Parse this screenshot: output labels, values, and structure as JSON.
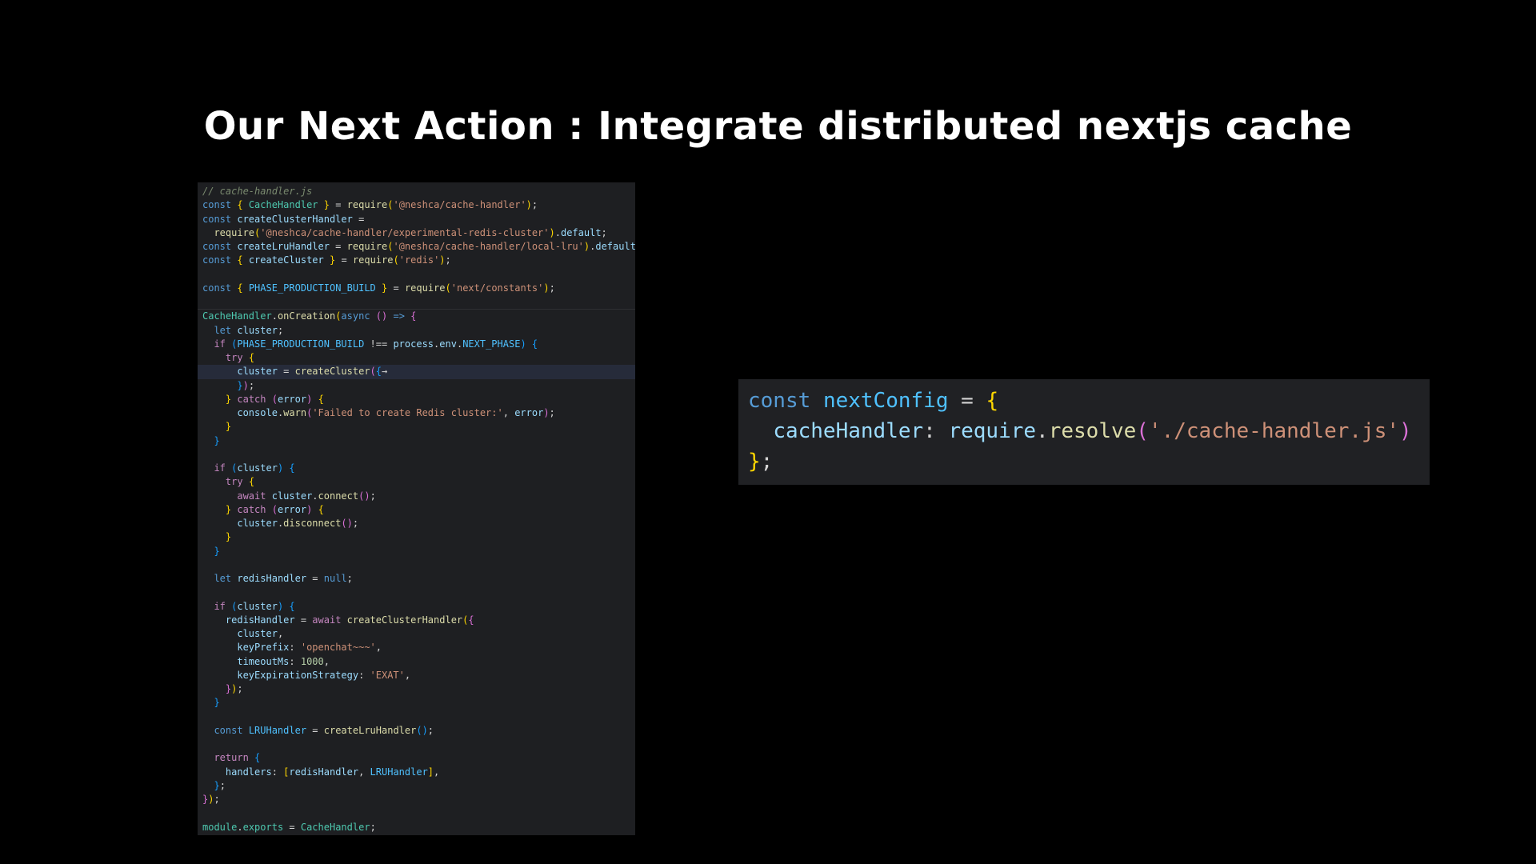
{
  "slide": {
    "title": "Our Next Action : Integrate distributed nextjs cache"
  },
  "colors": {
    "background": "#000000",
    "title": "#ffffff",
    "editor_background": "#1e1f22",
    "keyword": "#569cd6",
    "control_keyword": "#c586c0",
    "variable": "#9cdcfe",
    "class": "#4ec9b0",
    "function": "#dcdcaa",
    "string": "#ce9178",
    "number": "#b5cea8",
    "constant": "#4fc1ff",
    "bracket_level_1": "#ffd700",
    "bracket_level_2": "#da70d6",
    "bracket_level_3": "#179fff"
  },
  "left_code": {
    "filename_comment": "// cache-handler.js",
    "lines": [
      [
        [
          "cm",
          "// cache-handler.js"
        ]
      ],
      [
        [
          "kw",
          "const"
        ],
        [
          "p",
          " "
        ],
        [
          "b1",
          "{"
        ],
        [
          "p",
          " "
        ],
        [
          "cls",
          "CacheHandler"
        ],
        [
          "p",
          " "
        ],
        [
          "b1",
          "}"
        ],
        [
          "p",
          " = "
        ],
        [
          "fn",
          "require"
        ],
        [
          "b1",
          "("
        ],
        [
          "s",
          "'@neshca/cache-handler'"
        ],
        [
          "b1",
          ")"
        ],
        [
          "p",
          ";"
        ]
      ],
      [
        [
          "kw",
          "const"
        ],
        [
          "p",
          " "
        ],
        [
          "v",
          "createClusterHandler"
        ],
        [
          "p",
          " ="
        ]
      ],
      [
        [
          "p",
          "  "
        ],
        [
          "fn",
          "require"
        ],
        [
          "b1",
          "("
        ],
        [
          "s",
          "'@neshca/cache-handler/experimental-redis-cluster'"
        ],
        [
          "b1",
          ")"
        ],
        [
          "p",
          "."
        ],
        [
          "v",
          "default"
        ],
        [
          "p",
          ";"
        ]
      ],
      [
        [
          "kw",
          "const"
        ],
        [
          "p",
          " "
        ],
        [
          "v",
          "createLruHandler"
        ],
        [
          "p",
          " = "
        ],
        [
          "fn",
          "require"
        ],
        [
          "b1",
          "("
        ],
        [
          "s",
          "'@neshca/cache-handler/local-lru'"
        ],
        [
          "b1",
          ")"
        ],
        [
          "p",
          "."
        ],
        [
          "v",
          "default"
        ],
        [
          "p",
          ";"
        ]
      ],
      [
        [
          "kw",
          "const"
        ],
        [
          "p",
          " "
        ],
        [
          "b1",
          "{"
        ],
        [
          "p",
          " "
        ],
        [
          "v",
          "createCluster"
        ],
        [
          "p",
          " "
        ],
        [
          "b1",
          "}"
        ],
        [
          "p",
          " = "
        ],
        [
          "fn",
          "require"
        ],
        [
          "b1",
          "("
        ],
        [
          "s",
          "'redis'"
        ],
        [
          "b1",
          ")"
        ],
        [
          "p",
          ";"
        ]
      ],
      [],
      [
        [
          "kw",
          "const"
        ],
        [
          "p",
          " "
        ],
        [
          "b1",
          "{"
        ],
        [
          "p",
          " "
        ],
        [
          "c",
          "PHASE_PRODUCTION_BUILD"
        ],
        [
          "p",
          " "
        ],
        [
          "b1",
          "}"
        ],
        [
          "p",
          " = "
        ],
        [
          "fn",
          "require"
        ],
        [
          "b1",
          "("
        ],
        [
          "s",
          "'next/constants'"
        ],
        [
          "b1",
          ")"
        ],
        [
          "p",
          ";"
        ]
      ],
      [],
      [
        [
          "cls",
          "CacheHandler"
        ],
        [
          "p",
          "."
        ],
        [
          "fn",
          "onCreation"
        ],
        [
          "b1",
          "("
        ],
        [
          "kw",
          "async"
        ],
        [
          "p",
          " "
        ],
        [
          "b2",
          "()"
        ],
        [
          "p",
          " "
        ],
        [
          "kw",
          "=>"
        ],
        [
          "p",
          " "
        ],
        [
          "b2",
          "{"
        ]
      ],
      [
        [
          "p",
          "  "
        ],
        [
          "kw",
          "let"
        ],
        [
          "p",
          " "
        ],
        [
          "v",
          "cluster"
        ],
        [
          "p",
          ";"
        ]
      ],
      [
        [
          "p",
          "  "
        ],
        [
          "kw2",
          "if"
        ],
        [
          "p",
          " "
        ],
        [
          "b3",
          "("
        ],
        [
          "c",
          "PHASE_PRODUCTION_BUILD"
        ],
        [
          "p",
          " !== "
        ],
        [
          "v",
          "process"
        ],
        [
          "p",
          "."
        ],
        [
          "v",
          "env"
        ],
        [
          "p",
          "."
        ],
        [
          "c",
          "NEXT_PHASE"
        ],
        [
          "b3",
          ")"
        ],
        [
          "p",
          " "
        ],
        [
          "b3",
          "{"
        ]
      ],
      [
        [
          "p",
          "    "
        ],
        [
          "kw2",
          "try"
        ],
        [
          "p",
          " "
        ],
        [
          "b1",
          "{"
        ]
      ],
      [
        [
          "p",
          "      "
        ],
        [
          "v",
          "cluster"
        ],
        [
          "p",
          " = "
        ],
        [
          "fn",
          "createCluster"
        ],
        [
          "b2",
          "("
        ],
        [
          "b3",
          "{"
        ],
        [
          "p",
          "→"
        ]
      ],
      [
        [
          "p",
          "      "
        ],
        [
          "b3",
          "}"
        ],
        [
          "b2",
          ")"
        ],
        [
          "p",
          ";"
        ]
      ],
      [
        [
          "p",
          "    "
        ],
        [
          "b1",
          "}"
        ],
        [
          "p",
          " "
        ],
        [
          "kw2",
          "catch"
        ],
        [
          "p",
          " "
        ],
        [
          "b2",
          "("
        ],
        [
          "v",
          "error"
        ],
        [
          "b2",
          ")"
        ],
        [
          "p",
          " "
        ],
        [
          "b1",
          "{"
        ]
      ],
      [
        [
          "p",
          "      "
        ],
        [
          "v",
          "console"
        ],
        [
          "p",
          "."
        ],
        [
          "fn",
          "warn"
        ],
        [
          "b2",
          "("
        ],
        [
          "s",
          "'Failed to create Redis cluster:'"
        ],
        [
          "p",
          ", "
        ],
        [
          "v",
          "error"
        ],
        [
          "b2",
          ")"
        ],
        [
          "p",
          ";"
        ]
      ],
      [
        [
          "p",
          "    "
        ],
        [
          "b1",
          "}"
        ]
      ],
      [
        [
          "p",
          "  "
        ],
        [
          "b3",
          "}"
        ]
      ],
      [],
      [
        [
          "p",
          "  "
        ],
        [
          "kw2",
          "if"
        ],
        [
          "p",
          " "
        ],
        [
          "b3",
          "("
        ],
        [
          "v",
          "cluster"
        ],
        [
          "b3",
          ")"
        ],
        [
          "p",
          " "
        ],
        [
          "b3",
          "{"
        ]
      ],
      [
        [
          "p",
          "    "
        ],
        [
          "kw2",
          "try"
        ],
        [
          "p",
          " "
        ],
        [
          "b1",
          "{"
        ]
      ],
      [
        [
          "p",
          "      "
        ],
        [
          "kw2",
          "await"
        ],
        [
          "p",
          " "
        ],
        [
          "v",
          "cluster"
        ],
        [
          "p",
          "."
        ],
        [
          "fn",
          "connect"
        ],
        [
          "b2",
          "()"
        ],
        [
          "p",
          ";"
        ]
      ],
      [
        [
          "p",
          "    "
        ],
        [
          "b1",
          "}"
        ],
        [
          "p",
          " "
        ],
        [
          "kw2",
          "catch"
        ],
        [
          "p",
          " "
        ],
        [
          "b2",
          "("
        ],
        [
          "v",
          "error"
        ],
        [
          "b2",
          ")"
        ],
        [
          "p",
          " "
        ],
        [
          "b1",
          "{"
        ]
      ],
      [
        [
          "p",
          "      "
        ],
        [
          "v",
          "cluster"
        ],
        [
          "p",
          "."
        ],
        [
          "fn",
          "disconnect"
        ],
        [
          "b2",
          "()"
        ],
        [
          "p",
          ";"
        ]
      ],
      [
        [
          "p",
          "    "
        ],
        [
          "b1",
          "}"
        ]
      ],
      [
        [
          "p",
          "  "
        ],
        [
          "b3",
          "}"
        ]
      ],
      [],
      [
        [
          "p",
          "  "
        ],
        [
          "kw",
          "let"
        ],
        [
          "p",
          " "
        ],
        [
          "v",
          "redisHandler"
        ],
        [
          "p",
          " = "
        ],
        [
          "kw",
          "null"
        ],
        [
          "p",
          ";"
        ]
      ],
      [],
      [
        [
          "p",
          "  "
        ],
        [
          "kw2",
          "if"
        ],
        [
          "p",
          " "
        ],
        [
          "b3",
          "("
        ],
        [
          "v",
          "cluster"
        ],
        [
          "b3",
          ")"
        ],
        [
          "p",
          " "
        ],
        [
          "b3",
          "{"
        ]
      ],
      [
        [
          "p",
          "    "
        ],
        [
          "v",
          "redisHandler"
        ],
        [
          "p",
          " = "
        ],
        [
          "kw2",
          "await"
        ],
        [
          "p",
          " "
        ],
        [
          "fn",
          "createClusterHandler"
        ],
        [
          "b1",
          "("
        ],
        [
          "b2",
          "{"
        ]
      ],
      [
        [
          "p",
          "      "
        ],
        [
          "v",
          "cluster"
        ],
        [
          "p",
          ","
        ]
      ],
      [
        [
          "p",
          "      "
        ],
        [
          "v",
          "keyPrefix"
        ],
        [
          "p",
          ": "
        ],
        [
          "s",
          "'openchat~~~'"
        ],
        [
          "p",
          ","
        ]
      ],
      [
        [
          "p",
          "      "
        ],
        [
          "v",
          "timeoutMs"
        ],
        [
          "p",
          ": "
        ],
        [
          "n",
          "1000"
        ],
        [
          "p",
          ","
        ]
      ],
      [
        [
          "p",
          "      "
        ],
        [
          "v",
          "keyExpirationStrategy"
        ],
        [
          "p",
          ": "
        ],
        [
          "s",
          "'EXAT'"
        ],
        [
          "p",
          ","
        ]
      ],
      [
        [
          "p",
          "    "
        ],
        [
          "b2",
          "}"
        ],
        [
          "b1",
          ")"
        ],
        [
          "p",
          ";"
        ]
      ],
      [
        [
          "p",
          "  "
        ],
        [
          "b3",
          "}"
        ]
      ],
      [],
      [
        [
          "p",
          "  "
        ],
        [
          "kw",
          "const"
        ],
        [
          "p",
          " "
        ],
        [
          "c",
          "LRUHandler"
        ],
        [
          "p",
          " = "
        ],
        [
          "fn",
          "createLruHandler"
        ],
        [
          "b3",
          "()"
        ],
        [
          "p",
          ";"
        ]
      ],
      [],
      [
        [
          "p",
          "  "
        ],
        [
          "kw2",
          "return"
        ],
        [
          "p",
          " "
        ],
        [
          "b3",
          "{"
        ]
      ],
      [
        [
          "p",
          "    "
        ],
        [
          "v",
          "handlers"
        ],
        [
          "p",
          ": "
        ],
        [
          "b1",
          "["
        ],
        [
          "v",
          "redisHandler"
        ],
        [
          "p",
          ", "
        ],
        [
          "c",
          "LRUHandler"
        ],
        [
          "b1",
          "]"
        ],
        [
          "p",
          ","
        ]
      ],
      [
        [
          "p",
          "  "
        ],
        [
          "b3",
          "}"
        ],
        [
          "p",
          ";"
        ]
      ],
      [
        [
          "b2",
          "}"
        ],
        [
          "b1",
          ")"
        ],
        [
          "p",
          ";"
        ]
      ],
      [],
      [
        [
          "cls",
          "module"
        ],
        [
          "p",
          "."
        ],
        [
          "cls",
          "exports"
        ],
        [
          "p",
          " = "
        ],
        [
          "cls",
          "CacheHandler"
        ],
        [
          "p",
          ";"
        ]
      ]
    ]
  },
  "right_code": {
    "lines": [
      [
        [
          "kw",
          "const"
        ],
        [
          "p",
          " "
        ],
        [
          "c",
          "nextConfig"
        ],
        [
          "p",
          " = "
        ],
        [
          "b1",
          "{"
        ]
      ],
      [
        [
          "p",
          "  "
        ],
        [
          "v",
          "cacheHandler"
        ],
        [
          "p",
          ": "
        ],
        [
          "v",
          "require"
        ],
        [
          "p",
          "."
        ],
        [
          "fn",
          "resolve"
        ],
        [
          "b2",
          "("
        ],
        [
          "s",
          "'./cache-handler.js'"
        ],
        [
          "b2",
          ")"
        ]
      ],
      [
        [
          "b1",
          "}"
        ],
        [
          "p",
          ";"
        ]
      ]
    ]
  }
}
